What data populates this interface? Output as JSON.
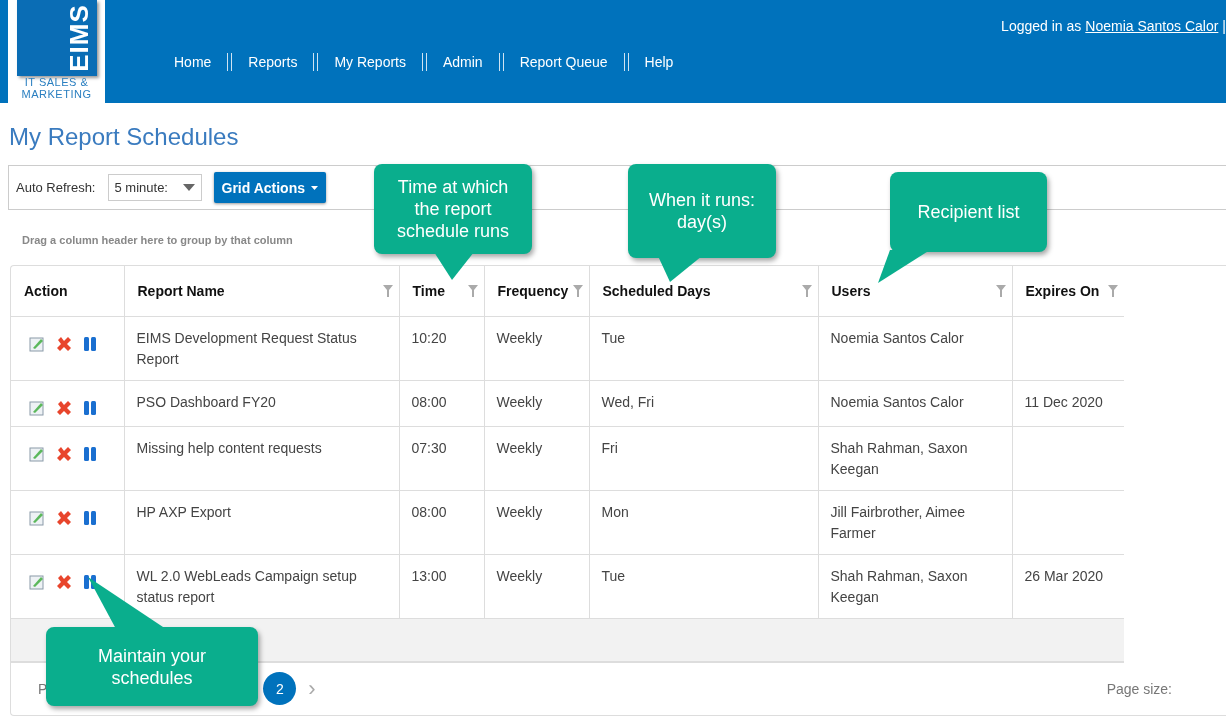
{
  "logo": {
    "mark": "EIMS",
    "line1": "IT SALES &",
    "line2": "MARKETING"
  },
  "nav": [
    "Home",
    "Reports",
    "My Reports",
    "Admin",
    "Report Queue",
    "Help"
  ],
  "user": {
    "prefix": "Logged in as",
    "name": "Noemia Santos Calor",
    "separator": "|"
  },
  "page_title": "My Report Schedules",
  "toolbar": {
    "auto_refresh_label": "Auto Refresh:",
    "auto_refresh_value": "5 minute:",
    "grid_actions": "Grid Actions"
  },
  "group_hint": "Drag a column header here to group by that column",
  "table": {
    "columns": [
      {
        "label": "Action",
        "filterable": false
      },
      {
        "label": "Report Name",
        "filterable": true
      },
      {
        "label": "Time",
        "filterable": true
      },
      {
        "label": "Frequency",
        "filterable": true
      },
      {
        "label": "Scheduled Days",
        "filterable": true
      },
      {
        "label": "Users",
        "filterable": true
      },
      {
        "label": "Expires On",
        "filterable": true
      }
    ],
    "rows": [
      {
        "report_name": "EIMS Development Request Status Report",
        "time": "10:20",
        "frequency": "Weekly",
        "scheduled_days": "Tue",
        "users": "Noemia Santos Calor",
        "expires_on": ""
      },
      {
        "report_name": "PSO Dashboard FY20",
        "time": "08:00",
        "frequency": "Weekly",
        "scheduled_days": "Wed, Fri",
        "users": "Noemia Santos Calor",
        "expires_on": "11 Dec 2020"
      },
      {
        "report_name": "Missing help content requests",
        "time": "07:30",
        "frequency": "Weekly",
        "scheduled_days": "Fri",
        "users": "Shah Rahman, Saxon Keegan",
        "expires_on": ""
      },
      {
        "report_name": "HP AXP Export",
        "time": "08:00",
        "frequency": "Weekly",
        "scheduled_days": "Mon",
        "users": "Jill Fairbrother, Aimee Farmer",
        "expires_on": ""
      },
      {
        "report_name": "WL 2.0 WebLeads Campaign setup status report",
        "time": "13:00",
        "frequency": "Weekly",
        "scheduled_days": "Tue",
        "users": "Shah Rahman, Saxon Keegan",
        "expires_on": "26 Mar 2020"
      }
    ]
  },
  "pager": {
    "label": "P",
    "pages": [
      {
        "label": "2",
        "selected": true
      }
    ],
    "next": "›",
    "page_size_label": "Page size:"
  },
  "callouts": [
    {
      "text": "Time at which the report schedule runs"
    },
    {
      "text": "When it runs: day(s)"
    },
    {
      "text": "Recipient list"
    },
    {
      "text": "Maintain your schedules"
    }
  ]
}
